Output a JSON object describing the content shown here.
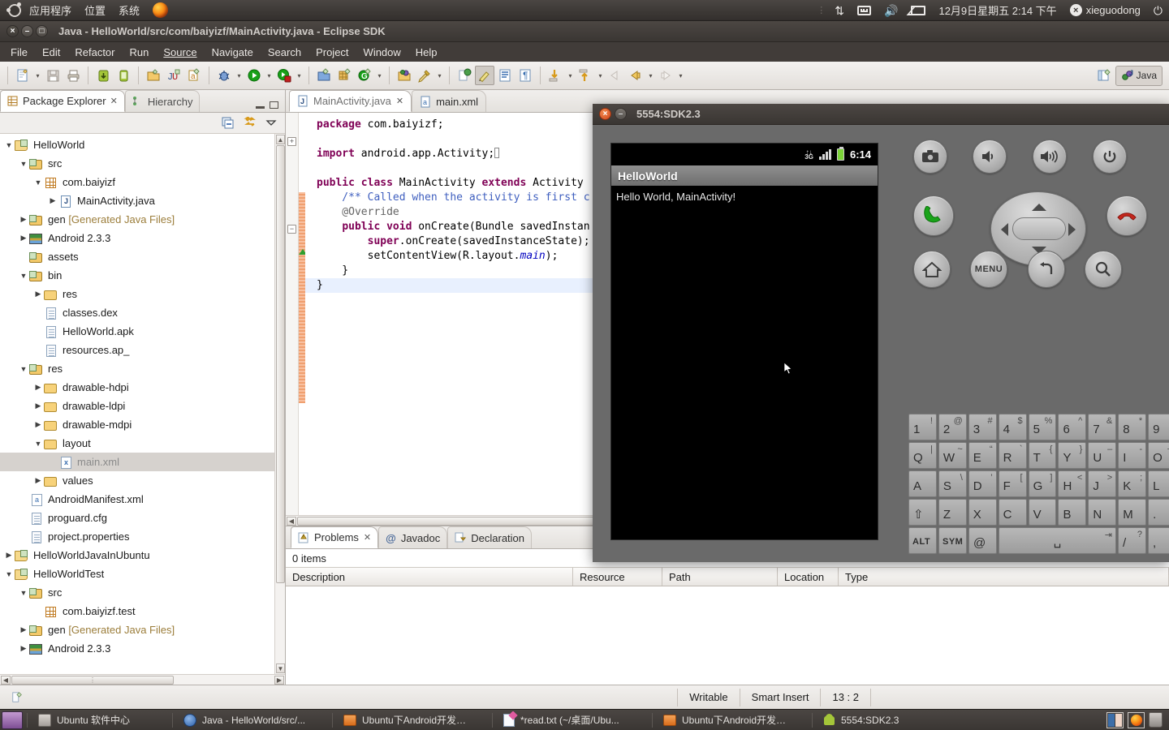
{
  "gnome_panel": {
    "menus": [
      "应用程序",
      "位置",
      "系统"
    ],
    "firefox_icon": "firefox-icon",
    "indicators": [
      "sync-icon",
      "keyboard-icon",
      "volume-icon",
      "mail-icon"
    ],
    "datetime": "12月9日星期五  2:14 下午",
    "user": "xieguodong",
    "power_icon": "power-icon"
  },
  "eclipse": {
    "title": "Java - HelloWorld/src/com/baiyizf/MainActivity.java - Eclipse SDK",
    "window_buttons": {
      "close": "×",
      "minimize": "–",
      "maximize": "□"
    },
    "menu": [
      "File",
      "Edit",
      "Refactor",
      "Run",
      "Source",
      "Navigate",
      "Search",
      "Project",
      "Window",
      "Help"
    ],
    "toolbar_icons": [
      "new-wizard-icon",
      "save-icon",
      "print-icon",
      "android-sdk-manager-icon",
      "android-avd-manager-icon",
      "new-java-project-icon",
      "new-junit-test-icon",
      "new-android-project-icon",
      "debug-icon",
      "run-icon",
      "external-tools-icon",
      "new-java-class-icon",
      "new-package-icon",
      "new-element-icon",
      "open-type-icon",
      "search-icon",
      "next-annotation-icon",
      "toggle-mark-occurrences-icon",
      "show-whitespace-icon",
      "show-print-margin-icon",
      "next-edit-icon",
      "previous-edit-icon",
      "back-icon",
      "forward-icon",
      "next-icon"
    ],
    "perspective": {
      "open_perspective_icon": "open-perspective-icon",
      "current": "Java"
    },
    "status": {
      "writable": "Writable",
      "insert_mode": "Smart Insert",
      "cursor": "13 : 2"
    }
  },
  "package_explorer": {
    "tabs": [
      {
        "label": "Package Explorer",
        "icon": "package-explorer-icon",
        "active": true,
        "closable": true
      },
      {
        "label": "Hierarchy",
        "icon": "hierarchy-icon",
        "active": false,
        "closable": false
      }
    ],
    "view_buttons": [
      "minimize-view-icon",
      "maximize-view-icon"
    ],
    "toolbar_buttons": [
      "collapse-all-icon",
      "link-with-editor-icon",
      "view-menu-icon"
    ],
    "tree": [
      {
        "indent": 0,
        "arrow": "▼",
        "icon": "java-project-icon",
        "label": "HelloWorld",
        "selected": false
      },
      {
        "indent": 1,
        "arrow": "▼",
        "icon": "source-folder-icon",
        "label": "src",
        "selected": false
      },
      {
        "indent": 2,
        "arrow": "▼",
        "icon": "package-icon",
        "label": "com.baiyizf",
        "selected": false
      },
      {
        "indent": 3,
        "arrow": "▶",
        "icon": "java-file-icon",
        "label": "MainActivity.java",
        "selected": false
      },
      {
        "indent": 1,
        "arrow": "▶",
        "icon": "gen-folder-icon",
        "label": "gen ",
        "dim": "[Generated Java Files]",
        "selected": false
      },
      {
        "indent": 1,
        "arrow": "▶",
        "icon": "android-lib-icon",
        "label": "Android 2.3.3",
        "selected": false
      },
      {
        "indent": 1,
        "arrow": "",
        "icon": "gen-folder-icon",
        "label": "assets",
        "selected": false
      },
      {
        "indent": 1,
        "arrow": "▼",
        "icon": "gen-folder-icon",
        "label": "bin",
        "selected": false
      },
      {
        "indent": 2,
        "arrow": "▶",
        "icon": "folder-icon",
        "label": "res",
        "selected": false
      },
      {
        "indent": 2,
        "arrow": "",
        "icon": "file-icon",
        "label": "classes.dex",
        "selected": false
      },
      {
        "indent": 2,
        "arrow": "",
        "icon": "file-icon",
        "label": "HelloWorld.apk",
        "selected": false
      },
      {
        "indent": 2,
        "arrow": "",
        "icon": "file-icon",
        "label": "resources.ap_",
        "selected": false
      },
      {
        "indent": 1,
        "arrow": "▼",
        "icon": "gen-folder-icon",
        "label": "res",
        "selected": false
      },
      {
        "indent": 2,
        "arrow": "▶",
        "icon": "folder-icon",
        "label": "drawable-hdpi",
        "selected": false
      },
      {
        "indent": 2,
        "arrow": "▶",
        "icon": "folder-icon",
        "label": "drawable-ldpi",
        "selected": false
      },
      {
        "indent": 2,
        "arrow": "▶",
        "icon": "folder-icon",
        "label": "drawable-mdpi",
        "selected": false
      },
      {
        "indent": 2,
        "arrow": "▼",
        "icon": "folder-icon",
        "label": "layout",
        "selected": false
      },
      {
        "indent": 3,
        "arrow": "",
        "icon": "xml-file-icon",
        "label": "main.xml",
        "selected": true
      },
      {
        "indent": 2,
        "arrow": "▶",
        "icon": "folder-icon",
        "label": "values",
        "selected": false
      },
      {
        "indent": 1,
        "arrow": "",
        "icon": "manifest-icon",
        "label": "AndroidManifest.xml",
        "selected": false
      },
      {
        "indent": 1,
        "arrow": "",
        "icon": "file-icon",
        "label": "proguard.cfg",
        "selected": false
      },
      {
        "indent": 1,
        "arrow": "",
        "icon": "file-icon",
        "label": "project.properties",
        "selected": false
      },
      {
        "indent": 0,
        "arrow": "▶",
        "icon": "java-project-icon",
        "label": "HelloWorldJavaInUbuntu",
        "selected": false
      },
      {
        "indent": 0,
        "arrow": "▼",
        "icon": "java-project-icon",
        "label": "HelloWorldTest",
        "selected": false
      },
      {
        "indent": 1,
        "arrow": "▼",
        "icon": "source-folder-icon",
        "label": "src",
        "selected": false
      },
      {
        "indent": 2,
        "arrow": "",
        "icon": "package-icon",
        "label": "com.baiyizf.test",
        "selected": false
      },
      {
        "indent": 1,
        "arrow": "▶",
        "icon": "gen-folder-icon",
        "label": "gen ",
        "dim": "[Generated Java Files]",
        "selected": false
      },
      {
        "indent": 1,
        "arrow": "▶",
        "icon": "android-lib-icon",
        "label": "Android 2.3.3",
        "selected": false
      }
    ]
  },
  "editor": {
    "tabs": [
      {
        "label": "MainActivity.java",
        "icon": "java-file-icon",
        "active": true,
        "closable": true
      },
      {
        "label": "main.xml",
        "icon": "xml-file-icon",
        "active": false,
        "closable": false
      }
    ],
    "code_lines": [
      {
        "segments": [
          {
            "t": "package",
            "c": "kw"
          },
          {
            "t": " com.baiyizf;",
            "c": ""
          }
        ],
        "current": false
      },
      {
        "segments": [],
        "current": false
      },
      {
        "segments": [
          {
            "t": "import",
            "c": "kw"
          },
          {
            "t": " android.app.Activity;",
            "c": ""
          },
          {
            "t": "​",
            "c": "caret"
          }
        ],
        "current": false
      },
      {
        "segments": [],
        "current": false
      },
      {
        "segments": [
          {
            "t": "public class",
            "c": "kw"
          },
          {
            "t": " MainActivity ",
            "c": ""
          },
          {
            "t": "extends",
            "c": "kw"
          },
          {
            "t": " Activity",
            "c": ""
          }
        ],
        "current": false
      },
      {
        "segments": [
          {
            "t": "    /** Called when the activity is first c",
            "c": "cmt"
          }
        ],
        "current": false
      },
      {
        "segments": [
          {
            "t": "    @Override",
            "c": "ann"
          }
        ],
        "current": false
      },
      {
        "segments": [
          {
            "t": "    ",
            "c": ""
          },
          {
            "t": "public void",
            "c": "kw"
          },
          {
            "t": " onCreate(Bundle savedInstan",
            "c": ""
          }
        ],
        "current": false
      },
      {
        "segments": [
          {
            "t": "        ",
            "c": ""
          },
          {
            "t": "super",
            "c": "kw"
          },
          {
            "t": ".onCreate(savedInstanceState);",
            "c": ""
          }
        ],
        "current": false
      },
      {
        "segments": [
          {
            "t": "        setContentView(R.layout.",
            "c": ""
          },
          {
            "t": "main",
            "c": "fld"
          },
          {
            "t": ");",
            "c": ""
          }
        ],
        "current": false
      },
      {
        "segments": [
          {
            "t": "    }",
            "c": ""
          }
        ],
        "current": false
      },
      {
        "segments": [
          {
            "t": "}",
            "c": ""
          }
        ],
        "current": true
      }
    ]
  },
  "bottom_view": {
    "tabs": [
      {
        "label": "Problems",
        "icon": "problems-icon",
        "active": true,
        "closable": true
      },
      {
        "label": "Javadoc",
        "icon": "javadoc-icon",
        "active": false,
        "closable": false
      },
      {
        "label": "Declaration",
        "icon": "declaration-icon",
        "active": false,
        "closable": false
      }
    ],
    "count_text": "0 items",
    "columns": [
      "Description",
      "Resource",
      "Path",
      "Location",
      "Type"
    ],
    "rows": []
  },
  "emulator": {
    "title": "5554:SDK2.3",
    "window_buttons": {
      "close": "×",
      "minimize": "–"
    },
    "android": {
      "statusbar": {
        "network": "3G",
        "signal_icon": "signal-bars-icon",
        "battery_icon": "battery-icon",
        "time": "6:14"
      },
      "app_title": "HelloWorld",
      "content_text": "Hello World, MainActivity!"
    },
    "hw_buttons": [
      {
        "name": "camera-button",
        "glyph": "camera"
      },
      {
        "name": "volume-down-button",
        "glyph": "vol-down"
      },
      {
        "name": "volume-up-button",
        "glyph": "vol-up"
      },
      {
        "name": "power-button",
        "glyph": "power"
      },
      {
        "name": "call-button",
        "glyph": "call"
      },
      {
        "name": "end-call-button",
        "glyph": "endcall"
      },
      {
        "name": "home-button",
        "glyph": "home"
      },
      {
        "name": "menu-button",
        "glyph": "MENU"
      },
      {
        "name": "back-button",
        "glyph": "back"
      },
      {
        "name": "search-button",
        "glyph": "search"
      }
    ],
    "keyboard": {
      "row1": [
        {
          "main": "1",
          "sup": "!"
        },
        {
          "main": "2",
          "sup": "@"
        },
        {
          "main": "3",
          "sup": "#"
        },
        {
          "main": "4",
          "sup": "$"
        },
        {
          "main": "5",
          "sup": "%"
        },
        {
          "main": "6",
          "sup": "^"
        },
        {
          "main": "7",
          "sup": "&"
        },
        {
          "main": "8",
          "sup": "*"
        },
        {
          "main": "9",
          "sup": "("
        }
      ],
      "row2": [
        {
          "main": "Q",
          "sup": "|"
        },
        {
          "main": "W",
          "sup": "~"
        },
        {
          "main": "E",
          "sup": "“"
        },
        {
          "main": "R",
          "sup": "`"
        },
        {
          "main": "T",
          "sup": "{"
        },
        {
          "main": "Y",
          "sup": "}"
        },
        {
          "main": "U",
          "sup": "–"
        },
        {
          "main": "I",
          "sup": "-"
        },
        {
          "main": "O",
          "sup": "+"
        }
      ],
      "row3": [
        {
          "main": "A",
          "sup": ""
        },
        {
          "main": "S",
          "sup": "\\"
        },
        {
          "main": "D",
          "sup": "’"
        },
        {
          "main": "F",
          "sup": "["
        },
        {
          "main": "G",
          "sup": "]"
        },
        {
          "main": "H",
          "sup": "<"
        },
        {
          "main": "J",
          "sup": ">"
        },
        {
          "main": "K",
          "sup": ";"
        },
        {
          "main": "L",
          "sup": ":"
        }
      ],
      "row4": [
        {
          "main": "⇧",
          "sup": ""
        },
        {
          "main": "Z",
          "sup": ""
        },
        {
          "main": "X",
          "sup": ""
        },
        {
          "main": "C",
          "sup": ""
        },
        {
          "main": "V",
          "sup": ""
        },
        {
          "main": "B",
          "sup": ""
        },
        {
          "main": "N",
          "sup": ""
        },
        {
          "main": "M",
          "sup": ""
        },
        {
          "main": ".",
          "sup": ""
        }
      ],
      "row5": [
        {
          "main": "ALT",
          "sup": ""
        },
        {
          "main": "SYM",
          "sup": ""
        },
        {
          "main": "@",
          "sup": ""
        },
        {
          "main": "␣",
          "sup": "⇥"
        },
        {
          "main": "/",
          "sup": "?"
        },
        {
          "main": ",",
          "sup": ""
        }
      ]
    }
  },
  "taskbar": {
    "show_desktop_icon": "show-desktop-icon",
    "items": [
      {
        "icon": "software-center-icon",
        "label": "Ubuntu 软件中心"
      },
      {
        "icon": "eclipse-icon",
        "label": "Java - HelloWorld/src/..."
      },
      {
        "icon": "file-manager-icon",
        "label": "Ubuntu下Android开发…"
      },
      {
        "icon": "text-editor-icon",
        "label": "*read.txt (~/桌面/Ubu..."
      },
      {
        "icon": "file-manager-icon",
        "label": "Ubuntu下Android开发…"
      },
      {
        "icon": "android-emulator-icon",
        "label": "5554:SDK2.3"
      }
    ],
    "tray": [
      "workspace-switcher-icon",
      "firefox-tray-icon",
      "trash-icon"
    ]
  }
}
